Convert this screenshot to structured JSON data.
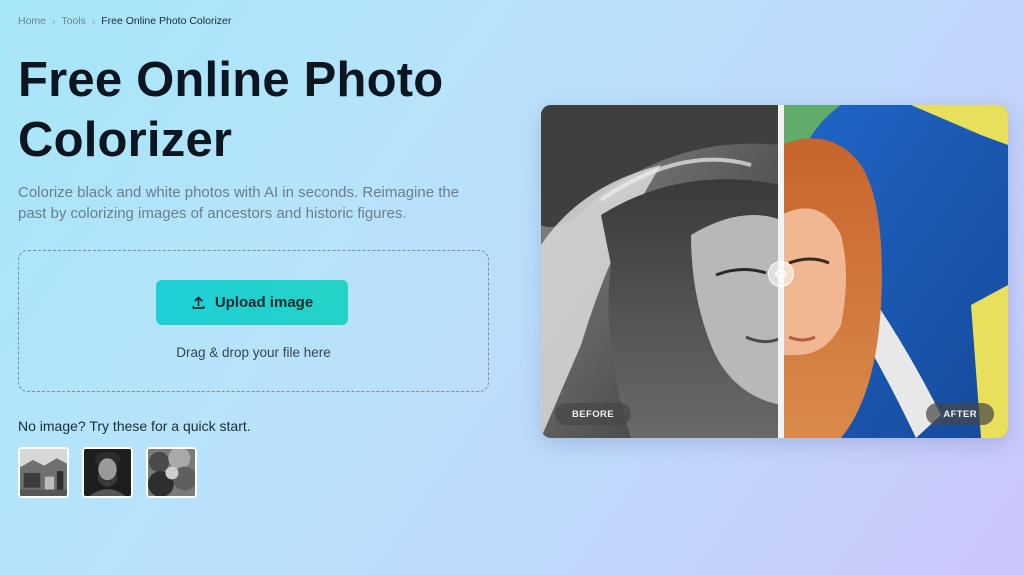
{
  "breadcrumb": {
    "home": "Home",
    "tools": "Tools",
    "current": "Free Online Photo Colorizer",
    "separator_icon": "chevron-right-icon"
  },
  "hero": {
    "title": "Free Online Photo Colorizer",
    "subtitle": "Colorize black and white photos with AI in seconds. Reimagine the past by colorizing images of ancestors and historic figures."
  },
  "upload": {
    "button_label": "Upload image",
    "button_icon": "upload-icon",
    "drop_text": "Drag & drop your file here",
    "accent_color": "#22d1cc"
  },
  "samples": {
    "label": "No image? Try these for a quick start.",
    "items": [
      {
        "icon": "sample-street-photo"
      },
      {
        "icon": "sample-portrait-photo"
      },
      {
        "icon": "sample-foliage-photo"
      }
    ]
  },
  "comparison": {
    "before_label": "BEFORE",
    "after_label": "AFTER",
    "handle_icon": "left-right-arrows-icon"
  }
}
